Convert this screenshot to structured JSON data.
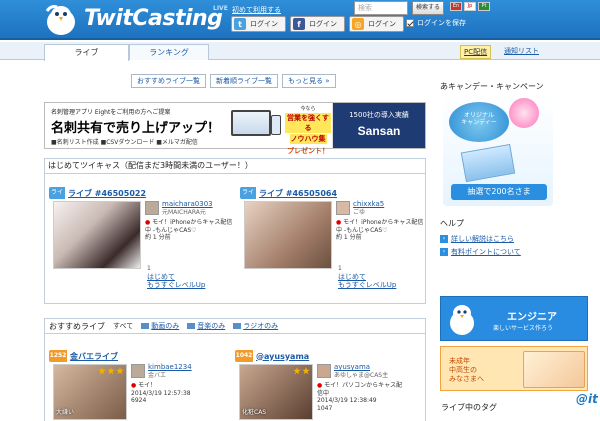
{
  "header": {
    "logo_text": "TwitCasting",
    "logo_badge": "LIVE",
    "first_visit_link": "初めて利用する",
    "login_twitter": "ログイン",
    "login_facebook": "ログイン",
    "login_other": "ログイン",
    "search_placeholder": "検索",
    "search_button": "検索する",
    "flags": [
      "En",
      "Jp",
      "Pt"
    ],
    "save_login": "ログインを保存"
  },
  "tabs": {
    "live": "ライブ",
    "ranking": "ランキング",
    "pc_broadcast": "PC配信",
    "notify_list": "通知リスト"
  },
  "subnav": [
    "おすすめライブ一覧",
    "新着順ライブ一覧",
    "もっと見る »"
  ],
  "banner": {
    "line1": "名刺管理アプリ Eightをご利用の方へご提案",
    "headline": "名刺共有で売り上げアップ！",
    "line3": "■名刺リスト作成 ■CSVダウンロード ■メルマガ配信",
    "note_small": "今なら",
    "note_em": "営業を強くする",
    "note_em2": "ノウハウ集",
    "note_present": "プレゼント！",
    "right_sub": "1500社の導入実績",
    "right_brand": "Sansan"
  },
  "newcomers": {
    "title": "はじめてツイキャス（配信まだ3時間未満のユーザー！）",
    "cards": [
      {
        "tag": "ライブ",
        "link": "ライブ #46505022",
        "user": "maichara0303",
        "user_sub": "元MAICHARA元",
        "comment": "モイ！iPhoneからキャス配信中 -もんじゃCAS♡",
        "viewers": "約 1 分前",
        "count": "1",
        "status1": "はじめて",
        "status2": "もうすぐレベルUp"
      },
      {
        "tag": "ライブ",
        "link": "ライブ #46505064",
        "user": "chixxka5",
        "user_sub": "ごゆ",
        "comment": "モイ！iPhoneからキャス配信中 -もんじゃCAS♡",
        "viewers": "約 1 分前",
        "count": "1",
        "status1": "はじめて",
        "status2": "もうすぐレベルUp"
      }
    ]
  },
  "recommended": {
    "title": "おすすめライブ",
    "tabs": [
      "すべて",
      "動画のみ",
      "音楽のみ",
      "ラジオのみ"
    ],
    "cards": [
      {
        "num": "1252",
        "link": "金バエライブ",
        "user": "kimbae1234",
        "user_sub": "金バエ",
        "comment": "モイ！",
        "date": "2014/3/19 12:57:38",
        "count": "6924",
        "caption": "大嫌い"
      },
      {
        "num": "1042",
        "link": "@ayusyama",
        "user": "ayusyama",
        "user_sub": "あゆしゃま@CAS主",
        "comment": "モイ！パソコンからキャス配信中",
        "date": "2014/3/19 12:38:49",
        "count": "1047",
        "caption": "化粧CAS"
      }
    ]
  },
  "sidebar": {
    "campaign_title": "あキャンデー・キャンペーン",
    "campaign_text1": "オリジナル",
    "campaign_text2": "キャンディー",
    "campaign_caption": "抽選で200名さま",
    "help_title": "ヘルプ",
    "help_links": [
      "詳しい解説はこちら",
      "有料ポイントについて"
    ],
    "engineer_title": "エンジニア",
    "engineer_sub": "楽しいサービス作ろう",
    "minor_text1": "未成年",
    "minor_text2": "中高生の",
    "minor_text3": "みなさまへ",
    "tags_title": "ライブ中のタグ"
  },
  "watermark": "@it"
}
